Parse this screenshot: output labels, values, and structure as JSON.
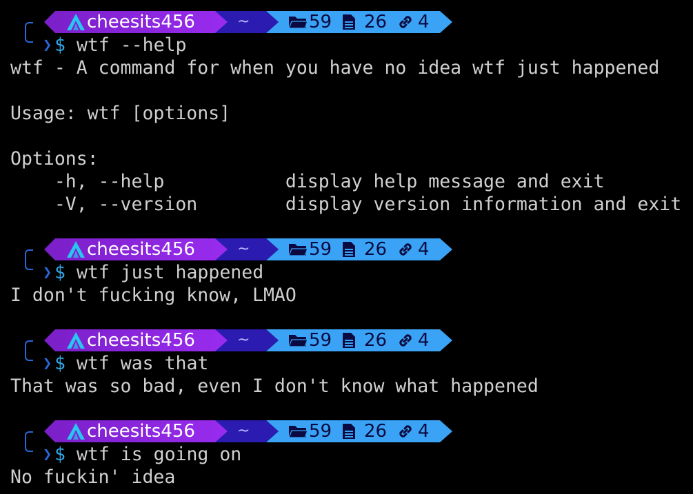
{
  "prompt": {
    "username": "cheesits456",
    "directory": "~",
    "folders": "59",
    "files": "26",
    "links": "4"
  },
  "colors": {
    "background": "#000000",
    "user_segment": "#8a2be2",
    "dir_segment": "#2b1bb0",
    "stats_segment": "#3aa3f5",
    "dollar": "#2ea8e8",
    "bracket": "#2a67d8",
    "text": "#d0d0d0"
  },
  "blocks": [
    {
      "command": "wtf --help",
      "output": [
        "wtf - A command for when you have no idea wtf just happened",
        "",
        "Usage: wtf [options]",
        "",
        "Options:",
        "    -h, --help           display help message and exit",
        "    -V, --version        display version information and exit"
      ]
    },
    {
      "command": "wtf just happened",
      "output": [
        "I don't fucking know, LMAO"
      ]
    },
    {
      "command": "wtf was that",
      "output": [
        "That was so bad, even I don't know what happened"
      ]
    },
    {
      "command": "wtf is going on",
      "output": [
        "No fuckin' idea"
      ]
    }
  ],
  "prompt_symbol": "$"
}
